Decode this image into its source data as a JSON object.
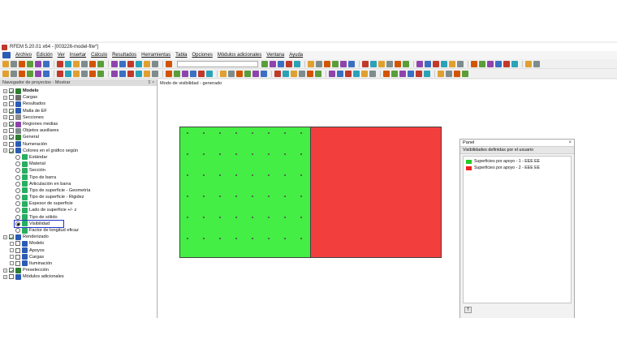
{
  "window": {
    "title": "RFEM 5.20.01 x64 - [003226-model-file*]"
  },
  "menu": {
    "items": [
      "Archivo",
      "Edición",
      "Ver",
      "Insertar",
      "Cálculo",
      "Resultados",
      "Herramientas",
      "Tabla",
      "Opciones",
      "Módulos adicionales",
      "Ventana",
      "Ayuda"
    ]
  },
  "navigator": {
    "title": "Navegador de proyectos - Mostrar",
    "pin_glyph": "⊼ ×",
    "tree": [
      {
        "label": "Modelo",
        "bold": true,
        "check": "checked",
        "icon_color": "#2e7d32"
      },
      {
        "label": "Cargas",
        "check": "unchecked",
        "icon_color": "#6d6d6d"
      },
      {
        "label": "Resultados",
        "check": "unchecked",
        "icon_color": "#2a5bb5"
      },
      {
        "label": "Malla de EF",
        "check": "checked",
        "icon_color": "#2a5bb5"
      },
      {
        "label": "Secciones",
        "check": "unchecked",
        "icon_color": "#8e8e8e"
      },
      {
        "label": "Regiones medias",
        "check": "checked",
        "icon_color": "#8e44ad"
      },
      {
        "label": "Objetos auxiliares",
        "check": "unchecked",
        "icon_color": "#7f8c8d"
      },
      {
        "label": "General",
        "check": "checked",
        "icon_color": "#2e7d32"
      },
      {
        "label": "Numeración",
        "check": "unchecked",
        "icon_color": "#2a5bb5"
      },
      {
        "label": "Colores en el gráfico según",
        "check": "checked",
        "icon_color": "#2a5bb5"
      },
      {
        "label": "Estándar",
        "radio": "off",
        "icon_color": "#27ae60"
      },
      {
        "label": "Material",
        "radio": "off",
        "icon_color": "#27ae60"
      },
      {
        "label": "Sección",
        "radio": "off",
        "icon_color": "#27ae60"
      },
      {
        "label": "Tipo de barra",
        "radio": "off",
        "icon_color": "#27ae60"
      },
      {
        "label": "Articulación en barra",
        "radio": "off",
        "icon_color": "#27ae60"
      },
      {
        "label": "Tipo de superficie - Geometría",
        "radio": "off",
        "icon_color": "#27ae60"
      },
      {
        "label": "Tipo de superficie - Rigidez",
        "radio": "off",
        "icon_color": "#27ae60"
      },
      {
        "label": "Espesor de superficie",
        "radio": "off",
        "icon_color": "#27ae60"
      },
      {
        "label": "Lado de superficie +/- z",
        "radio": "off",
        "icon_color": "#27ae60"
      },
      {
        "label": "Tipo de sólido",
        "radio": "off",
        "icon_color": "#27ae60"
      },
      {
        "label": "Visibilidad",
        "radio": "on",
        "icon_color": "#27ae60",
        "highlighted": true
      },
      {
        "label": "Factor de longitud eficaz",
        "radio": "off",
        "icon_color": "#27ae60"
      },
      {
        "label": "Renderizado",
        "check": "checked",
        "icon_color": "#2a5bb5"
      },
      {
        "label": "Modelo",
        "check": "unchecked",
        "icon_color": "#2a5bb5"
      },
      {
        "label": "Apoyos",
        "check": "unchecked",
        "icon_color": "#2a5bb5"
      },
      {
        "label": "Cargas",
        "check": "unchecked",
        "icon_color": "#2a5bb5"
      },
      {
        "label": "Iluminación",
        "check": "unchecked",
        "icon_color": "#2a5bb5"
      },
      {
        "label": "Preselección",
        "check": "checked",
        "icon_color": "#2e7d32"
      },
      {
        "label": "Módulos adicionales",
        "check": "unchecked",
        "icon_color": "#2a5bb5"
      }
    ]
  },
  "view": {
    "title": "Modo de visibilidad - generado",
    "surface_colors": [
      "#44ee44",
      "#f33e3e"
    ]
  },
  "panel": {
    "title": "Panel",
    "close_glyph": "×",
    "subtitle": "Visibilidades definidas por el usuario",
    "legend": [
      {
        "label": "Superficies por apoyo - 1 - EEE EE",
        "color": "#22cc22"
      },
      {
        "label": "Superficies por apoyo - 2 - EEE EE",
        "color": "#ee2222"
      }
    ],
    "button_glyph": "T"
  }
}
